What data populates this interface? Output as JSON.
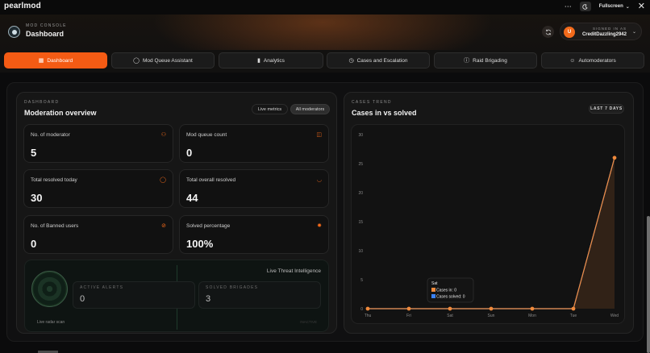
{
  "app": {
    "brand": "pearlmod"
  },
  "window": {
    "menu_icon": "ellipsis-icon",
    "theme_icon": "moon-icon",
    "mode_label": "Fullscreen",
    "close_icon": "close-icon"
  },
  "header": {
    "kicker": "MOD CONSOLE",
    "title": "Dashboard",
    "user": {
      "kicker": "SIGNED IN AS",
      "name": "CreditDazzling2942",
      "avatar_initial": "U"
    }
  },
  "nav": {
    "tabs": [
      {
        "label": "Dashboard",
        "icon": "grid-icon",
        "active": true
      },
      {
        "label": "Mod Queue Assistant",
        "icon": "shield-check-icon",
        "active": false
      },
      {
        "label": "Analytics",
        "icon": "bar-chart-icon",
        "active": false
      },
      {
        "label": "Cases and Escalation",
        "icon": "clock-icon",
        "active": false
      },
      {
        "label": "Raid Brigading",
        "icon": "alert-circle-icon",
        "active": false
      },
      {
        "label": "Automoderators",
        "icon": "user-icon",
        "active": false
      }
    ]
  },
  "overview": {
    "kicker": "DASHBOARD",
    "title": "Moderation overview",
    "chips": [
      "Live metrics",
      "All moderators"
    ],
    "cards": [
      {
        "label": "No. of moderator",
        "value": "5",
        "icon": "users-icon"
      },
      {
        "label": "Mod queue count",
        "value": "0",
        "icon": "inbox-icon"
      },
      {
        "label": "Total resolved today",
        "value": "30",
        "icon": "shield-icon"
      },
      {
        "label": "Total overall resolved",
        "value": "44",
        "icon": "gauge-icon"
      },
      {
        "label": "No. of Banned users",
        "value": "0",
        "icon": "ban-icon"
      },
      {
        "label": "Solved percentage",
        "value": "100%",
        "icon": "sparkle-icon"
      }
    ],
    "threat": {
      "title": "Live Threat Intelligence",
      "radar_label": "Live radar scan",
      "active_alerts_label": "ACTIVE ALERTS",
      "active_alerts_value": "0",
      "solved_brigades_label": "SOLVED BRIGADES",
      "solved_brigades_value": "3",
      "faint_label": "INACTIVE"
    }
  },
  "trend": {
    "kicker": "CASES TREND",
    "title": "Cases in vs solved",
    "range": "LAST 7 DAYS",
    "tooltip": {
      "title": "Sat",
      "line1": "Cases in: 0",
      "line2": "Cases solved: 0"
    }
  },
  "colors": {
    "accent": "#f45b14",
    "series_in": "#f08a3c",
    "series_solved": "#3b82f6"
  },
  "chart_data": {
    "type": "line",
    "categories": [
      "Thu",
      "Fri",
      "Sat",
      "Sun",
      "Mon",
      "Tue",
      "Wed"
    ],
    "series": [
      {
        "name": "Cases in",
        "values": [
          0,
          0,
          0,
          0,
          0,
          0,
          26
        ]
      },
      {
        "name": "Cases solved",
        "values": [
          0,
          0,
          0,
          0,
          0,
          0,
          26
        ]
      }
    ],
    "yticks": [
      0,
      5,
      10,
      15,
      20,
      25,
      30
    ],
    "ylim": [
      0,
      30
    ],
    "grid": false
  }
}
